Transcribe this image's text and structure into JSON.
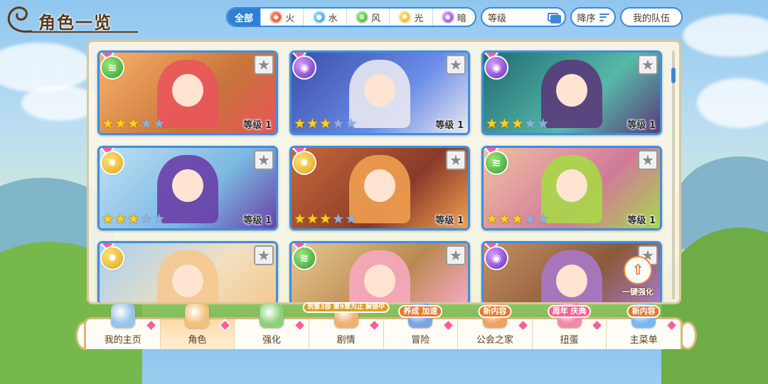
{
  "header": {
    "title": "角色一览"
  },
  "filters": {
    "all_label": "全部",
    "elements": [
      {
        "label": "火",
        "icon": "fire-element-icon",
        "color": "#d8321c"
      },
      {
        "label": "水",
        "icon": "water-element-icon",
        "color": "#1e7fd8"
      },
      {
        "label": "风",
        "icon": "wind-element-icon",
        "color": "#2e9c2e"
      },
      {
        "label": "光",
        "icon": "light-element-icon",
        "color": "#e3a417"
      },
      {
        "label": "暗",
        "icon": "dark-element-icon",
        "color": "#6b2bb8"
      }
    ]
  },
  "sort": {
    "select_value": "等级",
    "order_label": "降序",
    "team_label": "我的队伍"
  },
  "cards": [
    {
      "element": "wind",
      "stars": 3,
      "level_text": "等级 1",
      "art": [
        "#f7b46a",
        "#c9743a",
        "#e8555a"
      ]
    },
    {
      "element": "dark",
      "stars": 3,
      "level_text": "等级 1",
      "art": [
        "#3a4ea8",
        "#6a8ce8",
        "#e8e8f0"
      ]
    },
    {
      "element": "dark",
      "stars": 3,
      "level_text": "等级 1",
      "art": [
        "#1f6a72",
        "#57b9a8",
        "#5a3a7a"
      ]
    },
    {
      "element": "light",
      "stars": 3,
      "level_text": "等级 1",
      "art": [
        "#bfe0f5",
        "#7ab8e0",
        "#6a3fa8"
      ]
    },
    {
      "element": "light",
      "stars": 3,
      "level_text": "等级 1",
      "art": [
        "#c86a3a",
        "#8a3a2a",
        "#f0a050"
      ]
    },
    {
      "element": "wind",
      "stars": 3,
      "level_text": "等级 1",
      "art": [
        "#f0c0a0",
        "#d07a9a",
        "#a8d848"
      ]
    },
    {
      "element": "light",
      "stars": 0,
      "level_text": "",
      "art": [
        "#a8d0f0",
        "#f0e0c0",
        "#f5c890"
      ]
    },
    {
      "element": "wind",
      "stars": 0,
      "level_text": "",
      "art": [
        "#e8c890",
        "#b88a50",
        "#f7a8c0"
      ]
    },
    {
      "element": "dark",
      "stars": 0,
      "level_text": "",
      "art": [
        "#c89060",
        "#8a5a3a",
        "#a878c8"
      ]
    }
  ],
  "one_key_label": "一键强化",
  "nav": {
    "items": [
      {
        "label": "我的主页",
        "icon": "castle-icon",
        "tag": ""
      },
      {
        "label": "角色",
        "icon": "character-icon",
        "tag": ""
      },
      {
        "label": "强化",
        "icon": "enhance-icon",
        "tag": ""
      },
      {
        "label": "剧情",
        "icon": "story-icon",
        "tag": "到第3部 第9章为止 解锁中"
      },
      {
        "label": "冒险",
        "icon": "sword-icon",
        "tag": "养成 加速"
      },
      {
        "label": "公会之家",
        "icon": "guild-house-icon",
        "tag": "新内容"
      },
      {
        "label": "扭蛋",
        "icon": "gacha-icon",
        "tag": "周年 庆典"
      },
      {
        "label": "主菜单",
        "icon": "menu-crystal-icon",
        "tag": "新内容"
      }
    ]
  }
}
